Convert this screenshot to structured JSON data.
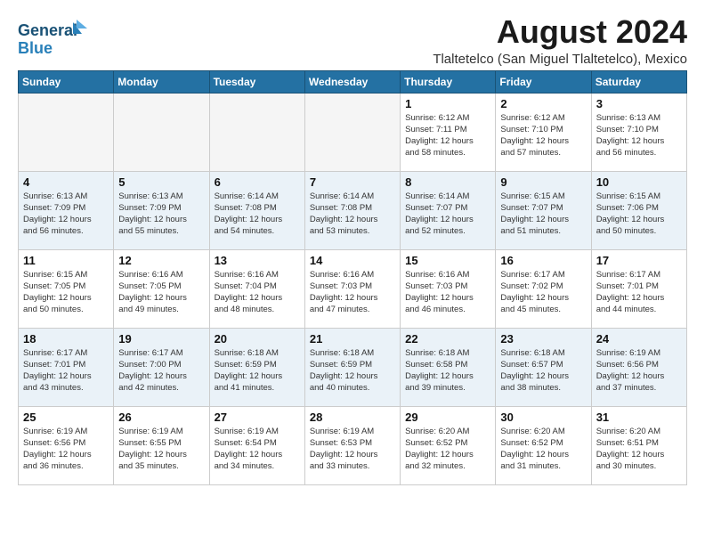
{
  "header": {
    "logo_line1": "General",
    "logo_line2": "Blue",
    "main_title": "August 2024",
    "subtitle": "Tlaltetelco (San Miguel Tlaltetelco), Mexico"
  },
  "days_of_week": [
    "Sunday",
    "Monday",
    "Tuesday",
    "Wednesday",
    "Thursday",
    "Friday",
    "Saturday"
  ],
  "weeks": [
    {
      "days": [
        {
          "num": "",
          "info": ""
        },
        {
          "num": "",
          "info": ""
        },
        {
          "num": "",
          "info": ""
        },
        {
          "num": "",
          "info": ""
        },
        {
          "num": "1",
          "info": "Sunrise: 6:12 AM\nSunset: 7:11 PM\nDaylight: 12 hours\nand 58 minutes."
        },
        {
          "num": "2",
          "info": "Sunrise: 6:12 AM\nSunset: 7:10 PM\nDaylight: 12 hours\nand 57 minutes."
        },
        {
          "num": "3",
          "info": "Sunrise: 6:13 AM\nSunset: 7:10 PM\nDaylight: 12 hours\nand 56 minutes."
        }
      ]
    },
    {
      "shaded": true,
      "days": [
        {
          "num": "4",
          "info": "Sunrise: 6:13 AM\nSunset: 7:09 PM\nDaylight: 12 hours\nand 56 minutes."
        },
        {
          "num": "5",
          "info": "Sunrise: 6:13 AM\nSunset: 7:09 PM\nDaylight: 12 hours\nand 55 minutes."
        },
        {
          "num": "6",
          "info": "Sunrise: 6:14 AM\nSunset: 7:08 PM\nDaylight: 12 hours\nand 54 minutes."
        },
        {
          "num": "7",
          "info": "Sunrise: 6:14 AM\nSunset: 7:08 PM\nDaylight: 12 hours\nand 53 minutes."
        },
        {
          "num": "8",
          "info": "Sunrise: 6:14 AM\nSunset: 7:07 PM\nDaylight: 12 hours\nand 52 minutes."
        },
        {
          "num": "9",
          "info": "Sunrise: 6:15 AM\nSunset: 7:07 PM\nDaylight: 12 hours\nand 51 minutes."
        },
        {
          "num": "10",
          "info": "Sunrise: 6:15 AM\nSunset: 7:06 PM\nDaylight: 12 hours\nand 50 minutes."
        }
      ]
    },
    {
      "days": [
        {
          "num": "11",
          "info": "Sunrise: 6:15 AM\nSunset: 7:05 PM\nDaylight: 12 hours\nand 50 minutes."
        },
        {
          "num": "12",
          "info": "Sunrise: 6:16 AM\nSunset: 7:05 PM\nDaylight: 12 hours\nand 49 minutes."
        },
        {
          "num": "13",
          "info": "Sunrise: 6:16 AM\nSunset: 7:04 PM\nDaylight: 12 hours\nand 48 minutes."
        },
        {
          "num": "14",
          "info": "Sunrise: 6:16 AM\nSunset: 7:03 PM\nDaylight: 12 hours\nand 47 minutes."
        },
        {
          "num": "15",
          "info": "Sunrise: 6:16 AM\nSunset: 7:03 PM\nDaylight: 12 hours\nand 46 minutes."
        },
        {
          "num": "16",
          "info": "Sunrise: 6:17 AM\nSunset: 7:02 PM\nDaylight: 12 hours\nand 45 minutes."
        },
        {
          "num": "17",
          "info": "Sunrise: 6:17 AM\nSunset: 7:01 PM\nDaylight: 12 hours\nand 44 minutes."
        }
      ]
    },
    {
      "shaded": true,
      "days": [
        {
          "num": "18",
          "info": "Sunrise: 6:17 AM\nSunset: 7:01 PM\nDaylight: 12 hours\nand 43 minutes."
        },
        {
          "num": "19",
          "info": "Sunrise: 6:17 AM\nSunset: 7:00 PM\nDaylight: 12 hours\nand 42 minutes."
        },
        {
          "num": "20",
          "info": "Sunrise: 6:18 AM\nSunset: 6:59 PM\nDaylight: 12 hours\nand 41 minutes."
        },
        {
          "num": "21",
          "info": "Sunrise: 6:18 AM\nSunset: 6:59 PM\nDaylight: 12 hours\nand 40 minutes."
        },
        {
          "num": "22",
          "info": "Sunrise: 6:18 AM\nSunset: 6:58 PM\nDaylight: 12 hours\nand 39 minutes."
        },
        {
          "num": "23",
          "info": "Sunrise: 6:18 AM\nSunset: 6:57 PM\nDaylight: 12 hours\nand 38 minutes."
        },
        {
          "num": "24",
          "info": "Sunrise: 6:19 AM\nSunset: 6:56 PM\nDaylight: 12 hours\nand 37 minutes."
        }
      ]
    },
    {
      "days": [
        {
          "num": "25",
          "info": "Sunrise: 6:19 AM\nSunset: 6:56 PM\nDaylight: 12 hours\nand 36 minutes."
        },
        {
          "num": "26",
          "info": "Sunrise: 6:19 AM\nSunset: 6:55 PM\nDaylight: 12 hours\nand 35 minutes."
        },
        {
          "num": "27",
          "info": "Sunrise: 6:19 AM\nSunset: 6:54 PM\nDaylight: 12 hours\nand 34 minutes."
        },
        {
          "num": "28",
          "info": "Sunrise: 6:19 AM\nSunset: 6:53 PM\nDaylight: 12 hours\nand 33 minutes."
        },
        {
          "num": "29",
          "info": "Sunrise: 6:20 AM\nSunset: 6:52 PM\nDaylight: 12 hours\nand 32 minutes."
        },
        {
          "num": "30",
          "info": "Sunrise: 6:20 AM\nSunset: 6:52 PM\nDaylight: 12 hours\nand 31 minutes."
        },
        {
          "num": "31",
          "info": "Sunrise: 6:20 AM\nSunset: 6:51 PM\nDaylight: 12 hours\nand 30 minutes."
        }
      ]
    }
  ]
}
